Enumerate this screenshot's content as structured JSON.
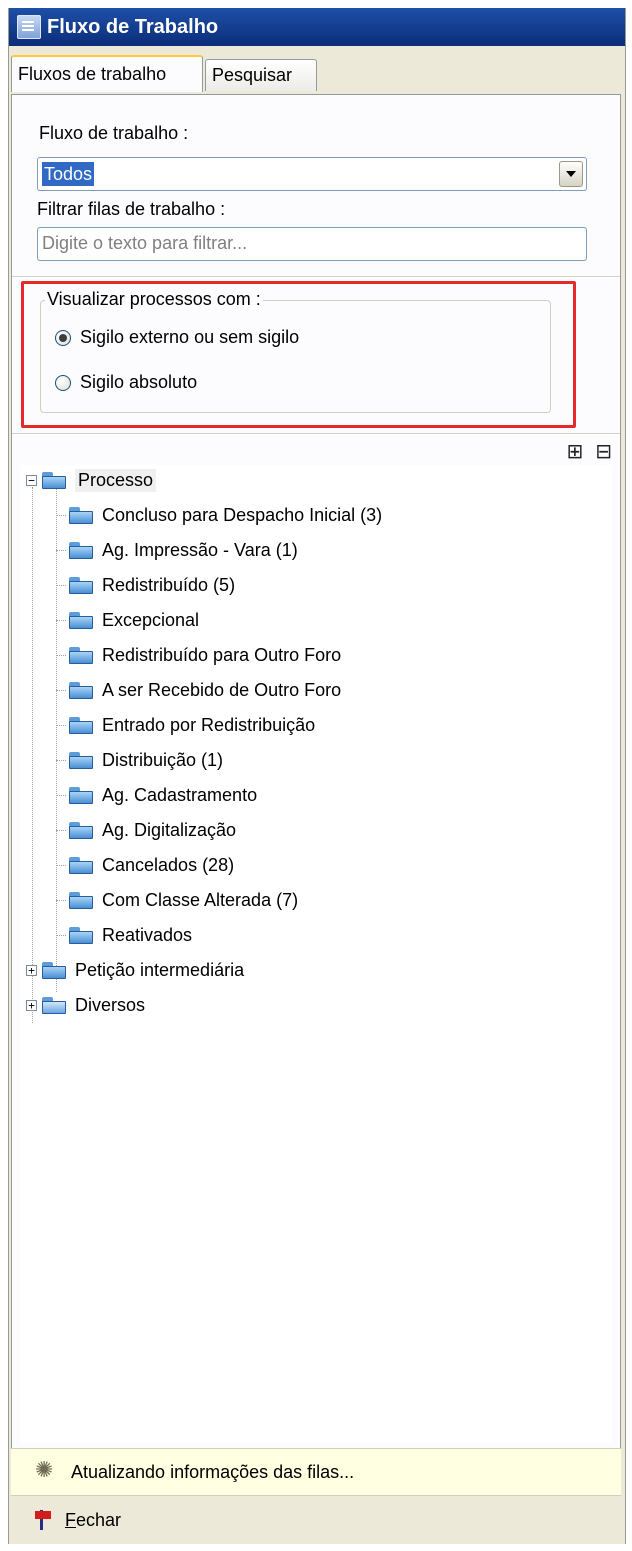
{
  "window": {
    "title": "Fluxo de Trabalho"
  },
  "tabs": [
    {
      "label": "Fluxos de trabalho",
      "active": true
    },
    {
      "label": "Pesquisar",
      "active": false
    }
  ],
  "filters": {
    "workflow_label": "Fluxo de trabalho :",
    "workflow_value": "Todos",
    "queue_filter_label": "Filtrar filas de trabalho :",
    "queue_filter_placeholder": "Digite o texto para filtrar..."
  },
  "visibility": {
    "legend": "Visualizar processos com :",
    "options": [
      {
        "label": "Sigilo externo ou sem sigilo",
        "checked": true
      },
      {
        "label": "Sigilo absoluto",
        "checked": false
      }
    ]
  },
  "toolbar": {
    "icons": [
      "tree-view-icon",
      "collapse-all-icon"
    ]
  },
  "tree": {
    "root": {
      "label": "Processo",
      "expanded": true
    },
    "children": [
      "Concluso para Despacho Inicial (3)",
      "Ag. Impressão - Vara (1)",
      "Redistribuído (5)",
      "Excepcional",
      "Redistribuído para Outro Foro",
      "A ser Recebido de Outro Foro",
      "Entrado por Redistribuição",
      "Distribuição (1)",
      "Ag. Cadastramento",
      "Ag. Digitalização",
      "Cancelados (28)",
      "Com Classe Alterada (7)",
      "Reativados"
    ],
    "siblings": [
      {
        "label": "Petição intermediária",
        "expanded": false
      },
      {
        "label": "Diversos",
        "expanded": false
      }
    ]
  },
  "status": {
    "text": "Atualizando informações das filas..."
  },
  "footer": {
    "close_label": "Fechar"
  }
}
